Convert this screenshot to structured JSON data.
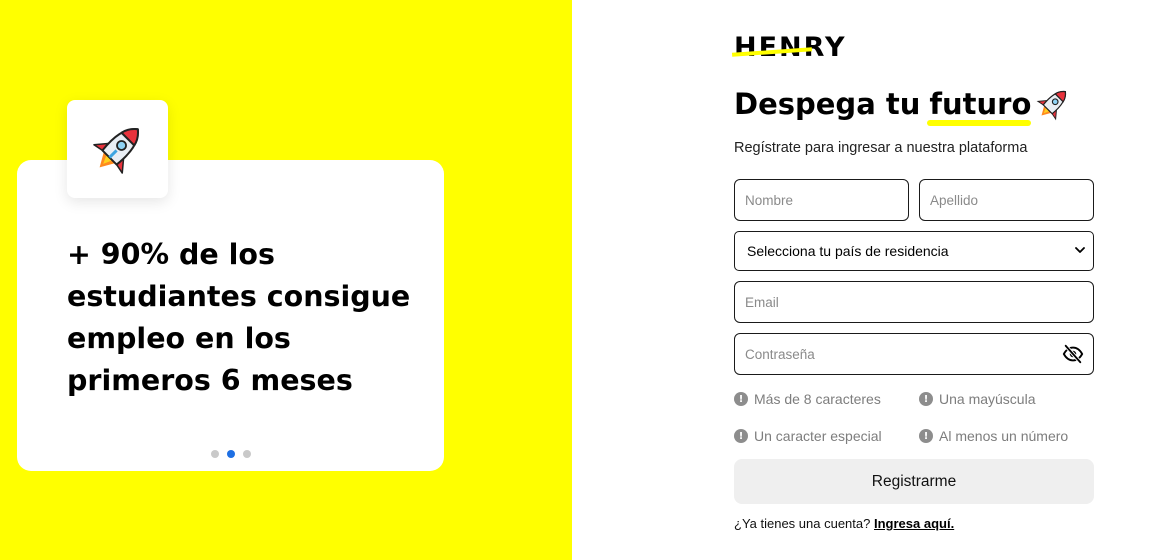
{
  "promo": {
    "icon": "rocket-icon",
    "text": "+ 90% de los estudiantes consigue empleo en los primeros 6 meses",
    "carousel": {
      "total": 3,
      "active": 2
    }
  },
  "brand": {
    "logo_text": "HENRY"
  },
  "headline": {
    "prefix": "Despega tu",
    "highlight": "futuro",
    "icon": "rocket-icon"
  },
  "subtitle": "Regístrate para ingresar a nuestra plataforma",
  "form": {
    "first_name": {
      "placeholder": "Nombre",
      "value": ""
    },
    "last_name": {
      "placeholder": "Apellido",
      "value": ""
    },
    "country": {
      "selected": "Selecciona tu país de residencia"
    },
    "email": {
      "placeholder": "Email",
      "value": ""
    },
    "password": {
      "placeholder": "Contraseña",
      "value": "",
      "toggle_icon": "eye-slash-icon"
    }
  },
  "requirements": [
    {
      "label": "Más de 8 caracteres",
      "icon": "exclamation-circle-icon"
    },
    {
      "label": "Una mayúscula",
      "icon": "exclamation-circle-icon"
    },
    {
      "label": "Un caracter especial",
      "icon": "exclamation-circle-icon"
    },
    {
      "label": "Al menos un número",
      "icon": "exclamation-circle-icon"
    }
  ],
  "submit_label": "Registrarme",
  "login_prompt": {
    "question": "¿Ya tienes una cuenta?",
    "link": "Ingresa aquí."
  },
  "colors": {
    "accent_yellow": "#ffff00",
    "carousel_active": "#1e6fe3",
    "button_bg": "#efefef"
  }
}
